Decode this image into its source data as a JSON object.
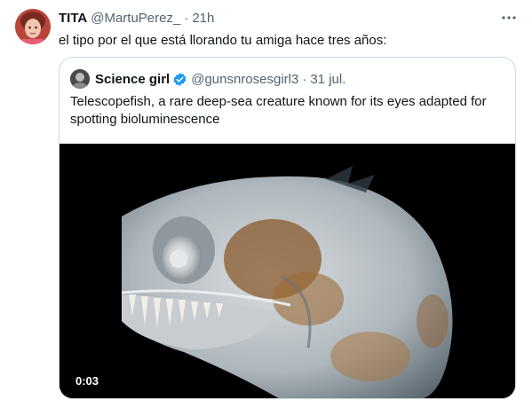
{
  "tweet": {
    "display_name": "TITA",
    "handle": "@MartuPerez_",
    "separator": "·",
    "time": "21h",
    "text": "el tipo por el que está llorando tu amiga hace tres años:",
    "more_icon": "more-horizontal-icon"
  },
  "quoted_tweet": {
    "display_name": "Science girl",
    "verified_icon": "verified-badge-icon",
    "handle": "@gunsnrosesgirl3",
    "separator": "·",
    "time": "31 jul.",
    "text": "Telescopefish, a rare deep-sea creature known for its eyes adapted for spotting bioluminescence",
    "video": {
      "duration": "0:03"
    }
  },
  "colors": {
    "text_primary": "#0f1419",
    "text_secondary": "#536471",
    "border": "#cfd9de",
    "verified_blue": "#1d9bf0",
    "media_background": "#000000"
  }
}
